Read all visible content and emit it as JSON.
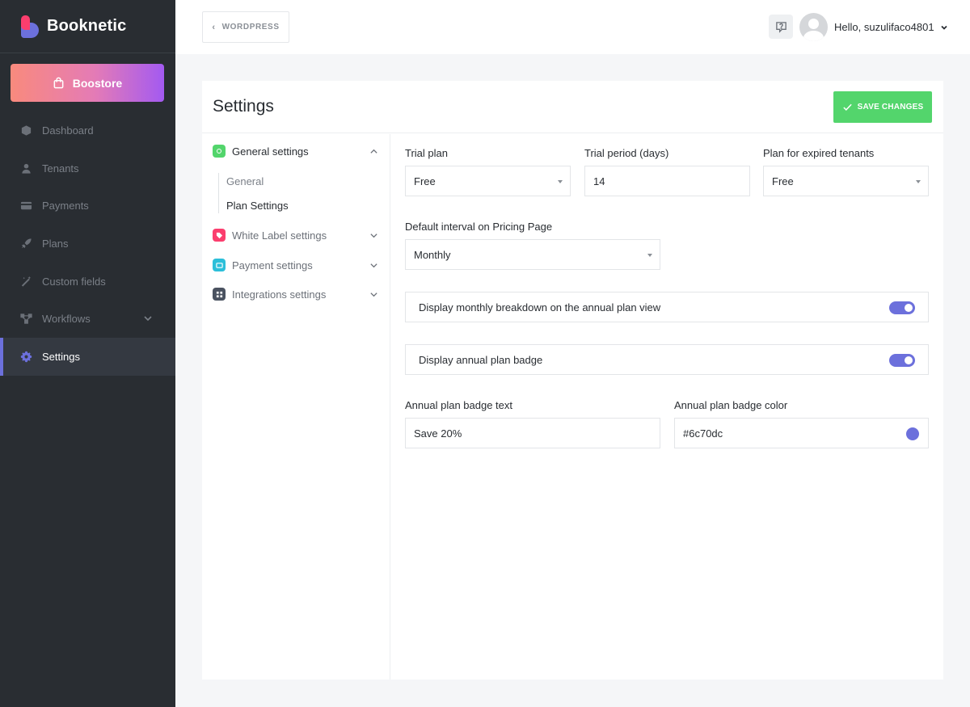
{
  "brand": {
    "name": "Booknetic",
    "colors": {
      "pink": "#fb3e6e",
      "purple": "#6c70dc"
    }
  },
  "sidebar": {
    "boostore_label": "Boostore",
    "items": [
      {
        "label": "Dashboard",
        "icon": "dashboard-icon"
      },
      {
        "label": "Tenants",
        "icon": "user-icon"
      },
      {
        "label": "Payments",
        "icon": "credit-card-icon"
      },
      {
        "label": "Plans",
        "icon": "rocket-icon"
      },
      {
        "label": "Custom fields",
        "icon": "magic-wand-icon"
      },
      {
        "label": "Workflows",
        "icon": "workflow-icon"
      },
      {
        "label": "Settings",
        "icon": "gear-icon",
        "active": true
      }
    ]
  },
  "topbar": {
    "back_label": "WORDPRESS",
    "greeting": "Hello, suzulifaco4801"
  },
  "page": {
    "title": "Settings",
    "save_label": "SAVE CHANGES"
  },
  "menu": {
    "general": {
      "label": "General settings",
      "color": "#53d56c"
    },
    "sub_items": [
      "General",
      "Plan Settings"
    ],
    "white_label": {
      "label": "White Label settings",
      "color": "#fb3e6e"
    },
    "payment": {
      "label": "Payment settings",
      "color": "#2cbfd9"
    },
    "integrations": {
      "label": "Integrations settings",
      "color": "#4a5260"
    }
  },
  "form": {
    "trial_plan": {
      "label": "Trial plan",
      "value": "Free"
    },
    "trial_period": {
      "label": "Trial period (days)",
      "value": "14"
    },
    "expired_plan": {
      "label": "Plan for expired tenants",
      "value": "Free"
    },
    "default_interval": {
      "label": "Default interval on Pricing Page",
      "value": "Monthly"
    },
    "monthly_breakdown": {
      "label": "Display monthly breakdown on the annual plan view",
      "enabled": true
    },
    "annual_badge": {
      "label": "Display annual plan badge",
      "enabled": true
    },
    "badge_text": {
      "label": "Annual plan badge text",
      "value": "Save 20%"
    },
    "badge_color": {
      "label": "Annual plan badge color",
      "value": "#6c70dc"
    }
  }
}
